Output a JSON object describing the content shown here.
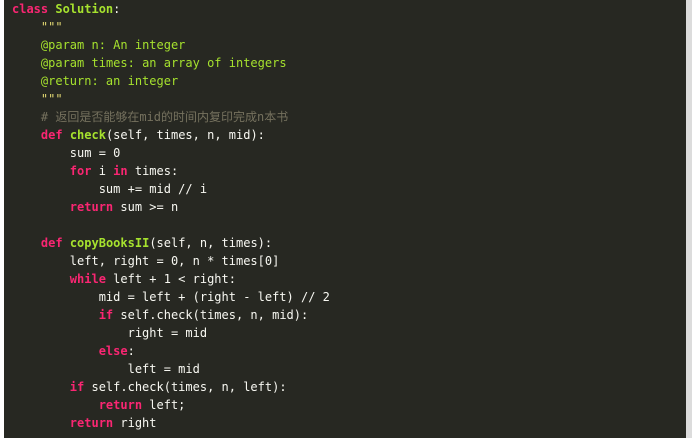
{
  "colors": {
    "background": "#272822",
    "keyword": "#f92672",
    "name": "#a6e22e",
    "string": "#e6db74",
    "comment": "#75715e",
    "text": "#f8f8f2"
  },
  "lines": [
    [
      {
        "t": "class",
        "c": "kw"
      },
      {
        "t": " ",
        "c": "txt"
      },
      {
        "t": "Solution",
        "c": "cls"
      },
      {
        "t": ":",
        "c": "txt"
      }
    ],
    [
      {
        "t": "    \"\"\"",
        "c": "doc"
      }
    ],
    [
      {
        "t": "    ",
        "c": "txt"
      },
      {
        "t": "@param",
        "c": "docparam"
      },
      {
        "t": " n: An integer",
        "c": "docparam"
      }
    ],
    [
      {
        "t": "    ",
        "c": "txt"
      },
      {
        "t": "@param",
        "c": "docparam"
      },
      {
        "t": " times: an array of integers",
        "c": "docparam"
      }
    ],
    [
      {
        "t": "    ",
        "c": "txt"
      },
      {
        "t": "@return",
        "c": "docparam"
      },
      {
        "t": ": an integer",
        "c": "docparam"
      }
    ],
    [
      {
        "t": "    \"\"\"",
        "c": "doc"
      }
    ],
    [
      {
        "t": "    # 返回是否能够在mid的时间内复印完成n本书",
        "c": "comment"
      }
    ],
    [
      {
        "t": "    ",
        "c": "txt"
      },
      {
        "t": "def",
        "c": "kw"
      },
      {
        "t": " ",
        "c": "txt"
      },
      {
        "t": "check",
        "c": "fn"
      },
      {
        "t": "(self, times, n, mid):",
        "c": "txt"
      }
    ],
    [
      {
        "t": "        sum = 0",
        "c": "txt"
      }
    ],
    [
      {
        "t": "        ",
        "c": "txt"
      },
      {
        "t": "for",
        "c": "kw"
      },
      {
        "t": " i ",
        "c": "txt"
      },
      {
        "t": "in",
        "c": "kw"
      },
      {
        "t": " times:",
        "c": "txt"
      }
    ],
    [
      {
        "t": "            sum += mid // i",
        "c": "txt"
      }
    ],
    [
      {
        "t": "        ",
        "c": "txt"
      },
      {
        "t": "return",
        "c": "kw"
      },
      {
        "t": " sum >= n",
        "c": "txt"
      }
    ],
    [
      {
        "t": "",
        "c": "txt"
      }
    ],
    [
      {
        "t": "    ",
        "c": "txt"
      },
      {
        "t": "def",
        "c": "kw"
      },
      {
        "t": " ",
        "c": "txt"
      },
      {
        "t": "copyBooksII",
        "c": "fn"
      },
      {
        "t": "(self, n, times):",
        "c": "txt"
      }
    ],
    [
      {
        "t": "        left, right = 0, n * times[0]",
        "c": "txt"
      }
    ],
    [
      {
        "t": "        ",
        "c": "txt"
      },
      {
        "t": "while",
        "c": "kw"
      },
      {
        "t": " left + 1 < right:",
        "c": "txt"
      }
    ],
    [
      {
        "t": "            mid = left + (right - left) // 2",
        "c": "txt"
      }
    ],
    [
      {
        "t": "            ",
        "c": "txt"
      },
      {
        "t": "if",
        "c": "kw"
      },
      {
        "t": " self.check(times, n, mid):",
        "c": "txt"
      }
    ],
    [
      {
        "t": "                right = mid",
        "c": "txt"
      }
    ],
    [
      {
        "t": "            ",
        "c": "txt"
      },
      {
        "t": "else",
        "c": "kw"
      },
      {
        "t": ":",
        "c": "txt"
      }
    ],
    [
      {
        "t": "                left = mid",
        "c": "txt"
      }
    ],
    [
      {
        "t": "        ",
        "c": "txt"
      },
      {
        "t": "if",
        "c": "kw"
      },
      {
        "t": " self.check(times, n, left):",
        "c": "txt"
      }
    ],
    [
      {
        "t": "            ",
        "c": "txt"
      },
      {
        "t": "return",
        "c": "kw"
      },
      {
        "t": " left;",
        "c": "txt"
      }
    ],
    [
      {
        "t": "        ",
        "c": "txt"
      },
      {
        "t": "return",
        "c": "kw"
      },
      {
        "t": " right",
        "c": "txt"
      }
    ]
  ]
}
